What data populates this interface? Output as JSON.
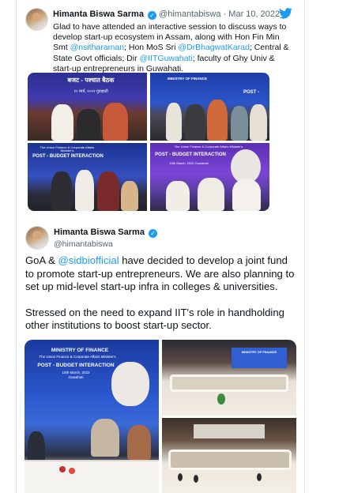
{
  "tweet1": {
    "author": "Himanta Biswa Sarma",
    "handle": "@himantabiswa",
    "date": "Mar 10, 2022",
    "separator": "·",
    "text_parts": [
      "Glad to have attended an interactive session to discuss ways to develop start-up ecosystem in Assam, along with Hon Fin Min Smt ",
      "@nsitharaman",
      "; Hon MoS Sri ",
      "@DrBhagwatKarad",
      "; Central & State Govt officials; Dir ",
      "@IITGuwahati",
      "; faculty of Ghy Univ & start-up entrepreneurs in Guwahati."
    ],
    "photos": [
      {
        "banner": "बजट - पश्चात बैठक",
        "sub": "१० मार्च, २०२२ गुवाहाटी"
      },
      {
        "banner": "MINISTRY OF FINANCE",
        "sub": "POST -"
      },
      {
        "banner": "POST - BUDGET INTERACTION",
        "sub": "The Union Finance & Corporate Affairs Minister's"
      },
      {
        "banner": "POST - BUDGET INTERACTION",
        "sub": "10th March, 2022 Guwahati",
        "top": "The Union Finance & Corporate Affairs Minister's"
      }
    ]
  },
  "tweet2": {
    "author": "Himanta Biswa Sarma",
    "handle": "@himantabiswa",
    "para1_parts": [
      "GoA & ",
      "@sidbiofficial",
      " have decided to develop a joint fund to promote start-up entrepreneurs. We are also planning to set up mid-level start-up infra in colleges & universities."
    ],
    "para2": "Stressed on the need to expand IIT's role in handholding other institutions to boost start-up sector.",
    "photos": [
      {
        "line1": "MINISTRY OF FINANCE",
        "line2": "The Union Finance & Corporate Affairs Minister's",
        "line3": "POST - BUDGET INTERACTION",
        "line4": "10th March, 2022",
        "line5": "Guwahati"
      },
      {
        "line1": "MINISTRY OF FINANCE"
      },
      {
        "line1": ""
      }
    ]
  },
  "colors": {
    "accent": "#1d9bf0",
    "text": "#0f1419",
    "muted": "#536471"
  },
  "icons": [
    "verified-badge-icon",
    "twitter-bird-icon"
  ]
}
